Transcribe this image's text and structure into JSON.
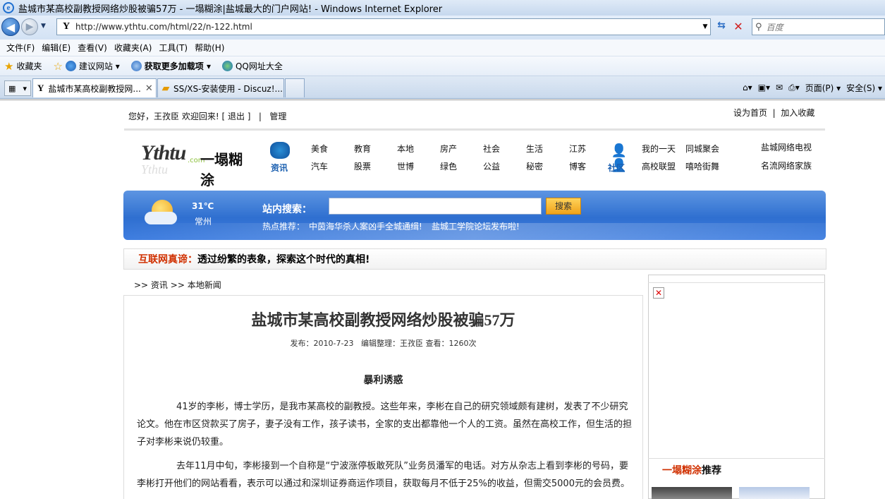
{
  "window": {
    "title": "盐城市某高校副教授网络炒股被骗57万 - 一塌糊涂|盐城最大的门户网站! - Windows Internet Explorer"
  },
  "address": {
    "url": "http://www.ythtu.com/html/22/n-122.html",
    "favicon": "Y"
  },
  "search": {
    "placeholder": "百度"
  },
  "menu": [
    "文件(F)",
    "编辑(E)",
    "查看(V)",
    "收藏夹(A)",
    "工具(T)",
    "帮助(H)"
  ],
  "favorites": {
    "favorites_label": "收藏夹",
    "suggested": "建议网站 ▾",
    "addons": "获取更多加载项 ▾",
    "qq": "QQ网址大全"
  },
  "tabs": [
    {
      "label": "盐城市某高校副教授网...",
      "favicon": "Y"
    },
    {
      "label": "SS/XS-安装使用 - Discuz!...",
      "favicon": "D"
    }
  ],
  "commands": {
    "page": "页面(P) ▾",
    "safety": "安全(S) ▾"
  },
  "header": {
    "greeting": "您好，王孜臣 欢迎回来!",
    "logout": "[ 退出 ]",
    "sep": "|",
    "manage": "管理",
    "set_home": "设为首页",
    "add_fav": "加入收藏",
    "top_sep": "|"
  },
  "logo": {
    "latin": "Ythtu",
    "com": ".com",
    "cn": "一塌糊涂"
  },
  "nav": {
    "zixun": "资讯",
    "shequ": "社区",
    "row1": [
      "美食",
      "教育",
      "本地",
      "房产",
      "社会",
      "生活",
      "江苏"
    ],
    "row2": [
      "汽车",
      "股票",
      "世博",
      "绿色",
      "公益",
      "秘密",
      "博客"
    ],
    "community_row1": [
      "我的一天",
      "同城聚会"
    ],
    "community_row2": [
      "高校联盟",
      "嘻哈街舞"
    ],
    "extra_row1": "盐城网络电视",
    "extra_row2": "名流网络家族"
  },
  "weather": {
    "temp": "31℃",
    "city": "常州"
  },
  "site_search": {
    "label": "站内搜索：",
    "button": "搜索",
    "hot_label": "热点推荐：",
    "hot1": "中茵海华杀人案凶手全城通缉!",
    "hot2": "盐城工学院论坛发布啦!"
  },
  "slogan": {
    "prefix": "互联网真谛：",
    "text": "透过纷繁的表象，探索这个时代的真相!"
  },
  "breadcrumb": {
    "a": ">> 资讯",
    "b": ">> 本地新闻"
  },
  "article": {
    "title": "盐城市某高校副教授网络炒股被骗57万",
    "meta": "发布：2010-7-23   编辑整理：王孜臣 查看：1260次",
    "subhead": "暴利诱惑",
    "para1": "41岁的李彬，博士学历，是我市某高校的副教授。这些年来，李彬在自己的研究领域颇有建树，发表了不少研究论文。他在市区贷款买了房子，妻子没有工作，孩子读书，全家的支出都靠他一个人的工资。虽然在高校工作，但生活的担子对李彬来说仍较重。",
    "para2": "去年11月中旬，李彬接到一个自称是“宁波涨停板敢死队”业务员潘军的电话。对方从杂志上看到李彬的号码，要李彬打开他们的网站看看，表示可以通过和深圳证券商运作项目，获取每月不低于25%的收益，但需交5000元的会员费。"
  },
  "sidebar": {
    "brand": "一塌糊涂",
    "suffix": "推荐"
  }
}
